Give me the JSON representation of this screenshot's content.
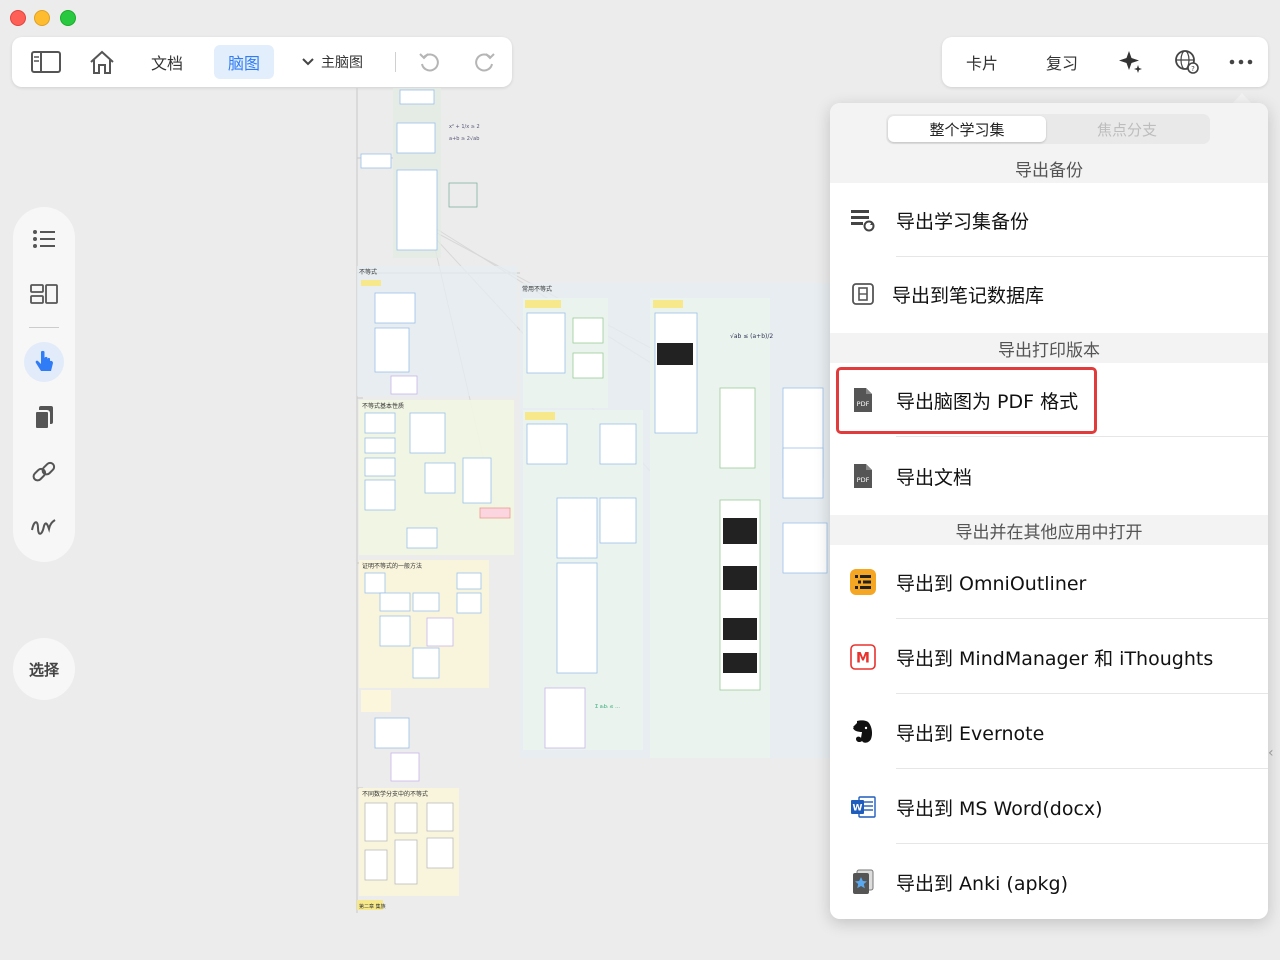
{
  "toolbar_left": {
    "doc_tab": "文档",
    "mindmap_tab": "脑图",
    "main_mindmap": "主脑图"
  },
  "toolbar_right": {
    "cards": "卡片",
    "review": "复习"
  },
  "sidebar": {
    "select_label": "选择"
  },
  "export_menu": {
    "segment": {
      "whole_set": "整个学习集",
      "focus_branch": "焦点分支"
    },
    "sections": {
      "backup": "导出备份",
      "print": "导出打印版本",
      "open_in": "导出并在其他应用中打开"
    },
    "items": {
      "backup_set": "导出学习集备份",
      "to_notes_db": "导出到笔记数据库",
      "mindmap_pdf": "导出脑图为 PDF 格式",
      "export_doc": "导出文档",
      "omnioutliner": "导出到 OmniOutliner",
      "mindmanager": "导出到 MindManager 和 iThoughts",
      "evernote": "导出到 Evernote",
      "msword": "导出到 MS Word(docx)",
      "anki": "导出到 Anki (apkg)"
    },
    "icon_labels": {
      "pdf": "PDF",
      "mm": "M",
      "word": "W"
    }
  },
  "mindmap": {
    "labels": {
      "inequality": "不等式",
      "common_inequality": "常用不等式",
      "basic_properties": "不等式基本性质",
      "proof_methods": "证明不等式的一般方法",
      "branch_inequality": "不同数学分支中的不等式",
      "chapter": "第二章 集族"
    }
  },
  "colors": {
    "accent": "#2f7cf6",
    "highlight_red": "#e23b3b",
    "omni_orange": "#f5a623",
    "mm_red": "#e8322e",
    "word_blue": "#1f5dbd"
  }
}
